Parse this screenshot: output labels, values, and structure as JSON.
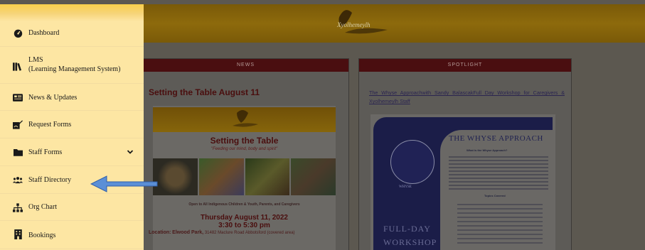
{
  "header": {
    "logo_text": "Xyolhemeylh"
  },
  "news": {
    "heading": "NEWS",
    "article_title": "Setting the Table August 11",
    "flyer": {
      "heading": "Setting the Table",
      "tagline": "\"Feeding our mind, body and spirit\"",
      "open_to": "Open to All Indigenous Children & Youth, Parents, and Caregivers",
      "date": "Thursday August 11, 2022",
      "time": "3:30 to 5:30 pm",
      "location_label": "Location:",
      "location_place": "Elwood Park,",
      "location_detail": "31482 Maclure Road Abbotsford (covered area)"
    }
  },
  "spotlight": {
    "heading": "SPOTLIGHT",
    "link_text": "The Whyse Approachwith Sandy BalascakFull Day Workshop for Caregivers & Xyolhemeylh Staff",
    "poster": {
      "title": "THE WHYSE APPROACH",
      "subtitle": "What is the Whyse Approach?",
      "topics_heading": "Topics Covered",
      "logo_text": "WHYSE",
      "full_day_1": "FULL-DAY",
      "full_day_2": "WORKSHOP"
    }
  },
  "sidebar": {
    "items": [
      {
        "label": "Dashboard",
        "icon": "dashboard-icon"
      },
      {
        "label": "LMS",
        "label2": "(Learning Management System)",
        "icon": "books-icon"
      },
      {
        "label": "News & Updates",
        "icon": "newspaper-icon"
      },
      {
        "label": "Request Forms",
        "icon": "signature-icon"
      },
      {
        "label": "Staff Forms",
        "icon": "folder-icon",
        "expandable": true
      },
      {
        "label": "Staff Directory",
        "icon": "users-icon"
      },
      {
        "label": "Org Chart",
        "icon": "sitemap-icon"
      },
      {
        "label": "Bookings",
        "icon": "building-icon"
      }
    ]
  },
  "colors": {
    "sidebar_bg": "#fde6a3",
    "sidebar_accent": "#f9cf4b",
    "arrow": "#5b8fd6",
    "panel_header": "#4a0e10"
  }
}
